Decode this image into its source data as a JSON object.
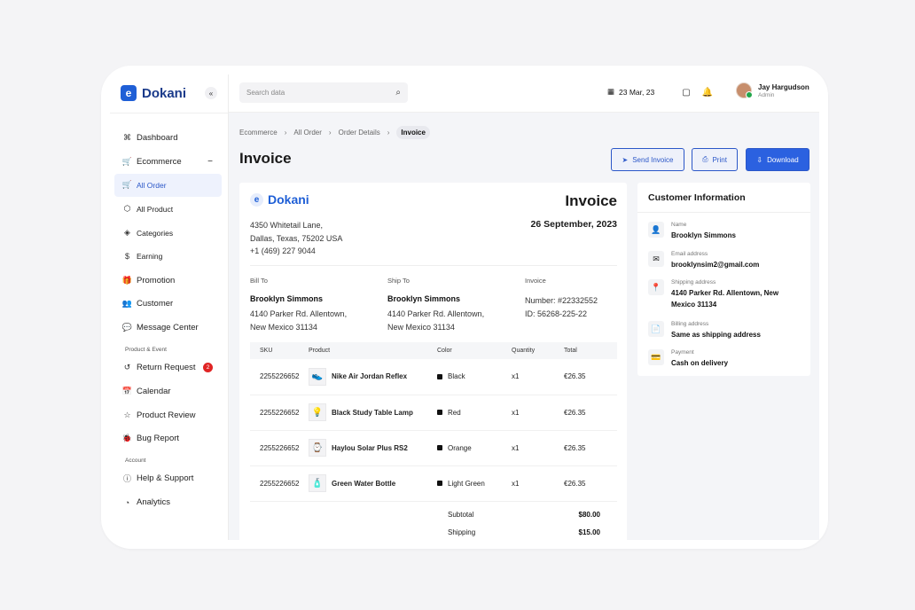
{
  "brand": {
    "name": "Dokani",
    "logo_letter": "e",
    "collapse_icon": "«"
  },
  "sidebar": {
    "items": [
      {
        "label": "Dashboard",
        "icon": "⌘"
      },
      {
        "label": "Ecommerce",
        "icon": "🛒",
        "toggle": "−"
      },
      {
        "label": "All Order",
        "icon": "🛒"
      },
      {
        "label": "All Product",
        "icon": "⬡"
      },
      {
        "label": "Categories",
        "icon": "◈"
      },
      {
        "label": "Earning",
        "icon": "$"
      },
      {
        "label": "Promotion",
        "icon": "🎁"
      },
      {
        "label": "Customer",
        "icon": "👥"
      },
      {
        "label": "Message Center",
        "icon": "💬"
      }
    ],
    "section_product": "Product & Event",
    "product_items": [
      {
        "label": "Return Request",
        "icon": "↺",
        "badge": "2"
      },
      {
        "label": "Calendar",
        "icon": "📅"
      },
      {
        "label": "Product Review",
        "icon": "☆"
      },
      {
        "label": "Bug Report",
        "icon": "🐞"
      }
    ],
    "section_account": "Account",
    "account_items": [
      {
        "label": "Help & Support",
        "icon": "ⓘ"
      },
      {
        "label": "Analytics",
        "icon": "◔"
      }
    ]
  },
  "topbar": {
    "search_placeholder": "Search data",
    "date": "23 Mar, 23",
    "user": {
      "name": "Jay Hargudson",
      "role": "Admin"
    }
  },
  "breadcrumb": [
    "Ecommerce",
    "All Order",
    "Order Details",
    "Invoice"
  ],
  "page_title": "Invoice",
  "actions": {
    "send": "Send Invoice",
    "print": "Print",
    "download": "Download"
  },
  "invoice": {
    "title": "Invoice",
    "date": "26 September, 2023",
    "address": [
      "4350 Whitetail Lane,",
      "Dallas, Texas, 75202 USA",
      "+1 (469) 227 9044"
    ],
    "bill_to": {
      "label": "Bill To",
      "name": "Brooklyn Simmons",
      "address": [
        "4140 Parker Rd. Allentown,",
        "New Mexico 31134"
      ]
    },
    "ship_to": {
      "label": "Ship To",
      "name": "Brooklyn Simmons",
      "address": [
        "4140 Parker Rd. Allentown,",
        "New Mexico 31134"
      ]
    },
    "meta": {
      "label": "Invoice",
      "number": "Number: #22332552",
      "id": "ID: 56268-225-22"
    },
    "columns": [
      "SKU",
      "Product",
      "Color",
      "Quantity",
      "Total"
    ],
    "rows": [
      {
        "sku": "2255226652",
        "product": "Nike Air Jordan Reflex",
        "color": "Black",
        "swatch": "#111111",
        "qty": "x1",
        "total": "€26.35",
        "thumb": "👟"
      },
      {
        "sku": "2255226652",
        "product": "Black Study Table Lamp",
        "color": "Red",
        "swatch": "#111111",
        "qty": "x1",
        "total": "€26.35",
        "thumb": "💡"
      },
      {
        "sku": "2255226652",
        "product": "Haylou Solar Plus RS2",
        "color": "Orange",
        "swatch": "#111111",
        "qty": "x1",
        "total": "€26.35",
        "thumb": "⌚"
      },
      {
        "sku": "2255226652",
        "product": "Green Water Bottle",
        "color": "Light Green",
        "swatch": "#111111",
        "qty": "x1",
        "total": "€26.35",
        "thumb": "🧴"
      }
    ],
    "subtotal_label": "Subtotal",
    "subtotal": "$80.00",
    "shipping_label": "Shipping",
    "shipping": "$15.00"
  },
  "customer": {
    "title": "Customer Information",
    "fields": [
      {
        "label": "Name",
        "value": "Brooklyn Simmons",
        "icon": "👤"
      },
      {
        "label": "Email address",
        "value": "brooklynsim2@gmail.com",
        "icon": "✉"
      },
      {
        "label": "Shipping address",
        "value": "4140 Parker Rd. Allentown, New Mexico 31134",
        "icon": "📍"
      },
      {
        "label": "Billing address",
        "value": "Same as shipping address",
        "icon": "📄"
      },
      {
        "label": "Payment",
        "value": "Cash on delivery",
        "icon": "💳"
      }
    ]
  },
  "colors": {
    "accent": "#2b61e0",
    "brand": "#1f5fd6",
    "badge": "#e02424"
  }
}
